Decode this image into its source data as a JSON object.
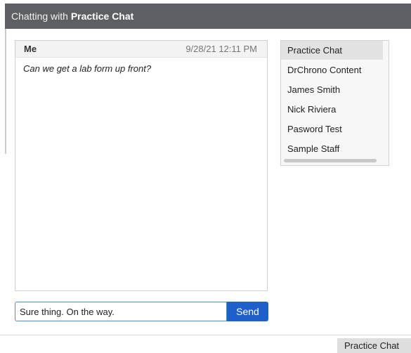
{
  "window": {
    "title_prefix": "Chatting with",
    "title_room": "Practice Chat"
  },
  "message": {
    "sender": "Me",
    "timestamp": "9/28/21 12:11 PM",
    "text": "Can we get a lab form up front?"
  },
  "rooms": [
    "Practice Chat",
    "DrChrono Content",
    "James Smith",
    "Nick Riviera",
    "Pasword Test",
    "Sample Staff"
  ],
  "active_room": "Practice Chat",
  "compose": {
    "value": "Sure thing. On the way.",
    "send_label": "Send"
  },
  "taskbar": {
    "tab_label": "Practice Chat"
  },
  "colors": {
    "titlebar": "#5d5f63",
    "send_button": "#1f5fc9",
    "input_border": "#4a90d9"
  }
}
